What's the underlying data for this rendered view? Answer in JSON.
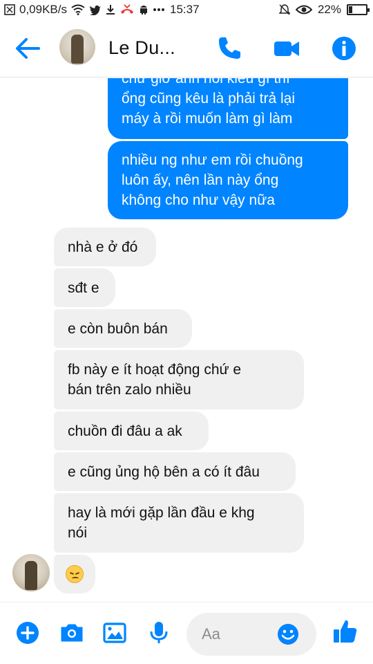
{
  "status_bar": {
    "network_speed": "0,09KB/s",
    "time": "15:37",
    "battery_percent": "22%",
    "battery_level": 0.22,
    "icons": [
      "notification-icon",
      "wifi-icon",
      "twitter-icon",
      "download-icon",
      "missed-call-icon",
      "android-icon",
      "more-icon",
      "mute-icon",
      "eye-icon",
      "battery-icon"
    ]
  },
  "header": {
    "contact_name": "Le Du...",
    "icons": [
      "back-arrow-icon",
      "phone-icon",
      "video-camera-icon",
      "info-icon"
    ]
  },
  "messages": [
    {
      "direction": "out",
      "lines": [
        "chứ giờ anh nói kiểu gì thì",
        "ổng cũng kêu là phải trả lại",
        "máy à rồi muốn làm gì làm"
      ]
    },
    {
      "direction": "out",
      "lines": [
        "nhiều ng như em rồi chuồng",
        "luôn ấy, nên lần này ổng",
        "không cho như vậy nữa"
      ]
    },
    {
      "direction": "in",
      "lines": [
        "nhà e ở đó"
      ]
    },
    {
      "direction": "in",
      "lines": [
        "sđt e"
      ]
    },
    {
      "direction": "in",
      "lines": [
        "e còn buôn bán"
      ]
    },
    {
      "direction": "in",
      "lines": [
        "fb này e ít hoạt động chứ e",
        "bán trên zalo nhiều"
      ]
    },
    {
      "direction": "in",
      "lines": [
        "chuồn đi đâu a ak"
      ]
    },
    {
      "direction": "in",
      "lines": [
        "e cũng ủng hộ bên a có ít đâu"
      ]
    },
    {
      "direction": "in",
      "lines": [
        "hay là mới gặp lần đầu e khg",
        "nói"
      ]
    },
    {
      "direction": "in",
      "emoji": "disappointed-face"
    }
  ],
  "composer": {
    "placeholder": "Aa",
    "icons": [
      "plus-icon",
      "camera-icon",
      "image-icon",
      "microphone-icon",
      "emoji-icon",
      "thumbs-up-icon"
    ]
  },
  "colors": {
    "accent": "#0084ff",
    "incoming_bubble": "#f1f0f0",
    "outgoing_bubble": "#0084ff"
  }
}
